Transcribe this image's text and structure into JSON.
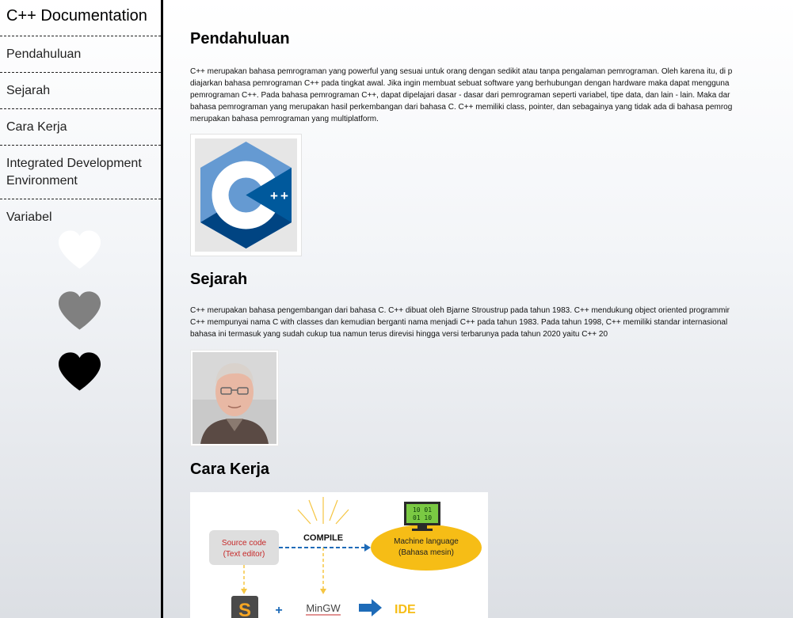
{
  "sidebar": {
    "title": "C++ Documentation",
    "items": [
      {
        "label": "Pendahuluan"
      },
      {
        "label": "Sejarah"
      },
      {
        "label": "Cara Kerja"
      },
      {
        "label": "Integrated Development Environment"
      },
      {
        "label": "Variabel"
      }
    ],
    "hearts": [
      {
        "color": "#ffffff"
      },
      {
        "color": "#808080"
      },
      {
        "color": "#000000"
      }
    ]
  },
  "sections": {
    "pendahuluan": {
      "heading": "Pendahuluan",
      "lines": [
        "C++ merupakan bahasa pemrograman yang powerful yang sesuai untuk orang dengan sedikit atau tanpa pengalaman pemrograman. Oleh karena itu, di p",
        "diajarkan bahasa pemrograman C++ pada tingkat awal. Jika ingin membuat sebuat software yang berhubungan dengan hardware maka dapat mengguna",
        "pemrograman C++. Pada bahasa pemrograman C++, dapat dipelajari dasar - dasar dari pemrograman seperti variabel, tipe data, dan lain - lain. Maka dar",
        "bahasa pemrograman yang merupakan hasil perkembangan dari bahasa C. C++ memiliki class, pointer, dan sebagainya yang tidak ada di bahasa pemrog",
        "merupakan bahasa pemrograman yang multiplatform."
      ],
      "logo_text": "C++"
    },
    "sejarah": {
      "heading": "Sejarah",
      "lines": [
        "C++ merupakan bahasa pengembangan dari bahasa C. C++ dibuat oleh Bjarne Stroustrup pada tahun 1983. C++ mendukung object oriented programmir",
        "C++ mempunyai nama C with classes dan kemudian berganti nama menjadi C++ pada tahun 1983. Pada tahun 1998, C++ memiliki standar internasional",
        "bahasa ini termasuk yang sudah cukup tua namun terus direvisi hingga versi terbarunya pada tahun 2020 yaitu C++ 20"
      ]
    },
    "cara_kerja": {
      "heading": "Cara Kerja",
      "diagram": {
        "source_line1": "Source code",
        "source_line2": "(Text editor)",
        "compile": "COMPILE",
        "machine_line1": "Machine language",
        "machine_line2": "(Bahasa mesin)",
        "editor_glyph": "S",
        "plus": "+",
        "mingw": "MinGW",
        "ide": "IDE",
        "binary_rows": [
          "10 01",
          "01 10"
        ]
      }
    }
  }
}
